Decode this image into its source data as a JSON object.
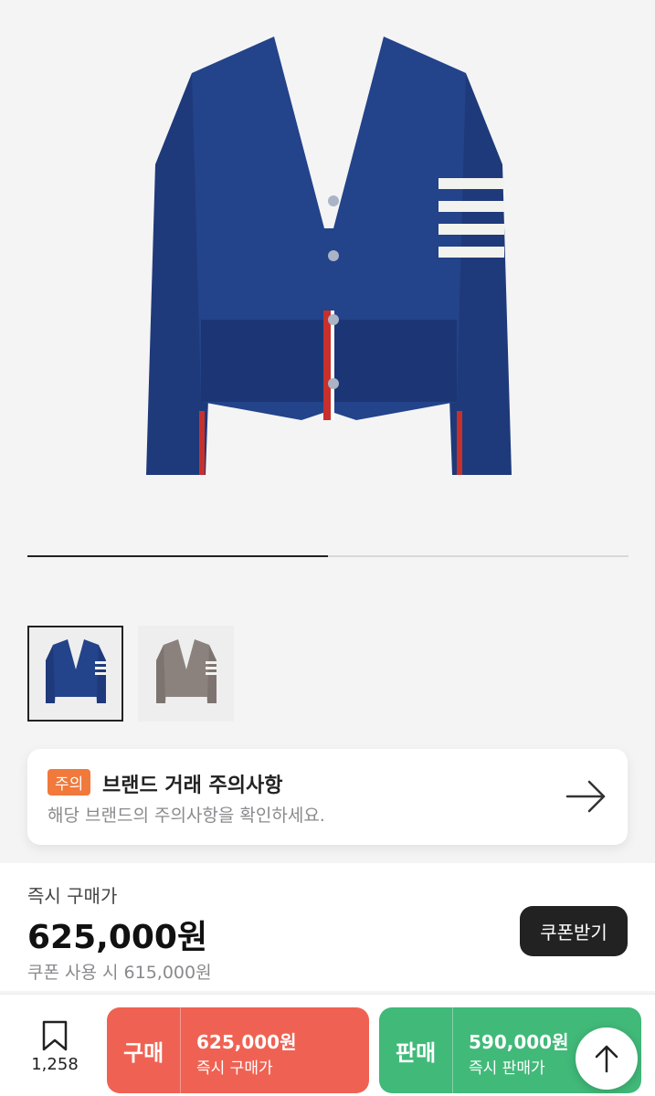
{
  "product": {
    "image_icon": "navy-cable-knit-cardigan",
    "thumbnails": [
      {
        "icon": "navy-cardigan-thumbnail",
        "selected": true
      },
      {
        "icon": "grey-cardigan-thumbnail",
        "selected": false
      }
    ],
    "gallery_progress": 0.5
  },
  "notice": {
    "tag": "주의",
    "title": "브랜드 거래 주의사항",
    "description": "해당 브랜드의 주의사항을 확인하세요."
  },
  "price": {
    "label": "즉시 구매가",
    "value": "625,000원",
    "coupon_text": "쿠폰 사용 시 615,000원",
    "coupon_button": "쿠폰받기"
  },
  "bottom_bar": {
    "wish_count": "1,258",
    "buy": {
      "label": "구매",
      "price": "625,000원",
      "sub": "즉시 구매가"
    },
    "sell": {
      "label": "판매",
      "price": "590,000원",
      "sub": "즉시 판매가"
    }
  },
  "colors": {
    "buy": "#ef6253",
    "sell": "#41b979",
    "notice_tag": "#f1793b"
  }
}
